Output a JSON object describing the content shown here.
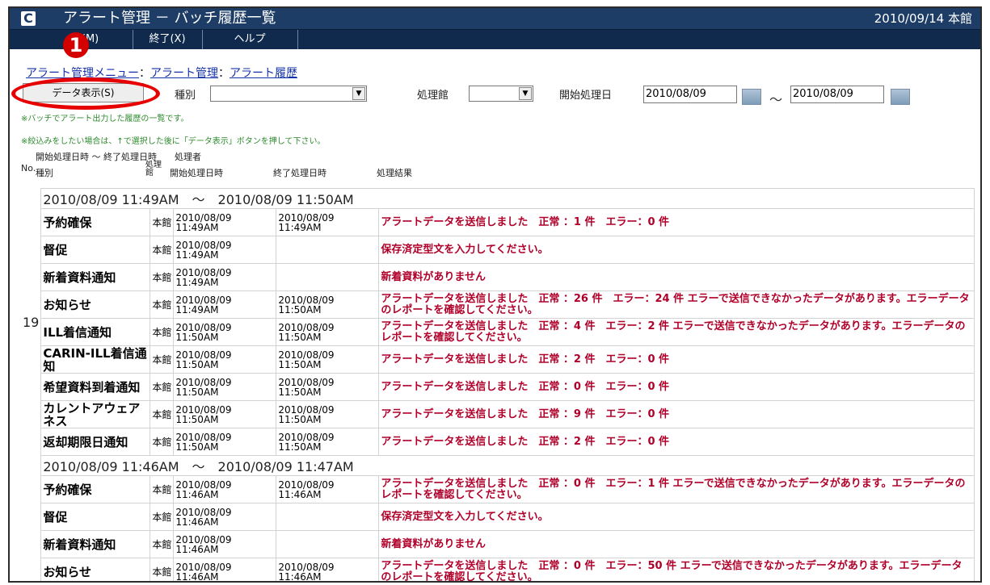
{
  "window": {
    "title": "アラート管理 － バッチ履歴一覧",
    "date_branch": "2010/09/14 本館",
    "logo": "C"
  },
  "menu": {
    "item1": "メ (M)",
    "item2": "終了(X)",
    "item3": "ヘルプ"
  },
  "callout": {
    "number": "1"
  },
  "breadcrumb": {
    "link1": "アラート管理メニュー",
    "sep1": "：",
    "link2": "アラート管理",
    "sep2": "：",
    "link3": "アラート履歴"
  },
  "toolbar": {
    "display_button": "データ表示(S)",
    "type_label": "種別",
    "branch_label": "処理館",
    "start_label": "開始処理日",
    "date_from": "2010/08/09",
    "tilde": "～",
    "date_to": "2010/08/09"
  },
  "info": {
    "line1": "※バッチでアラート出力した履歴の一覧です。",
    "line2": "※絞込みをしたい場合は、↑で選択した後に「データ表示」ボタンを押して下さい。"
  },
  "header": {
    "row1": "開始処理日時 ～ 終了処理日時　　処理者",
    "no": "No.",
    "type": "種別",
    "branch": "処理館",
    "start": "開始処理日時",
    "end": "終了処理日時",
    "result": "処理結果"
  },
  "groups": [
    {
      "no": "19",
      "title": "2010/08/09 11:49AM　～　2010/08/09 11:50AM",
      "rows": [
        {
          "type": "予約確保",
          "branch": "本館",
          "start1": "2010/08/09",
          "start2": "11:49AM",
          "end1": "2010/08/09",
          "end2": "11:49AM",
          "result": "アラートデータを送信しました　正常 ：1 件　エラー：0 件"
        },
        {
          "type": "督促",
          "branch": "本館",
          "start1": "2010/08/09",
          "start2": "11:49AM",
          "end1": "",
          "end2": "",
          "result": "保存済定型文を入力してください。"
        },
        {
          "type": "新着資料通知",
          "branch": "本館",
          "start1": "2010/08/09",
          "start2": "11:49AM",
          "end1": "",
          "end2": "",
          "result": "新着資料がありません"
        },
        {
          "type": "お知らせ",
          "branch": "本館",
          "start1": "2010/08/09",
          "start2": "11:49AM",
          "end1": "2010/08/09",
          "end2": "11:50AM",
          "result": "アラートデータを送信しました　正常 ：26 件　エラー：24 件 エラーで送信できなかったデータがあります。エラーデータのレポートを確認してください。"
        },
        {
          "type": "ILL着信通知",
          "branch": "本館",
          "start1": "2010/08/09",
          "start2": "11:50AM",
          "end1": "2010/08/09",
          "end2": "11:50AM",
          "result": "アラートデータを送信しました　正常 ：4 件　エラー：2 件 エラーで送信できなかったデータがあります。エラーデータのレポートを確認してください。"
        },
        {
          "type": "CARIN-ILL着信通知",
          "branch": "本館",
          "start1": "2010/08/09",
          "start2": "11:50AM",
          "end1": "2010/08/09",
          "end2": "11:50AM",
          "result": "アラートデータを送信しました　正常 ：2 件　エラー：0 件"
        },
        {
          "type": "希望資料到着通知",
          "branch": "本館",
          "start1": "2010/08/09",
          "start2": "11:50AM",
          "end1": "2010/08/09",
          "end2": "11:50AM",
          "result": "アラートデータを送信しました　正常 ：0 件　エラー：0 件"
        },
        {
          "type": "カレントアウェアネス",
          "branch": "本館",
          "start1": "2010/08/09",
          "start2": "11:50AM",
          "end1": "2010/08/09",
          "end2": "11:50AM",
          "result": "アラートデータを送信しました　正常 ：9 件　エラー：0 件"
        },
        {
          "type": "返却期限日通知",
          "branch": "本館",
          "start1": "2010/08/09",
          "start2": "11:50AM",
          "end1": "2010/08/09",
          "end2": "11:50AM",
          "result": "アラートデータを送信しました　正常 ：2 件　エラー：0 件"
        }
      ]
    },
    {
      "no": "",
      "title": "2010/08/09 11:46AM　～　2010/08/09 11:47AM",
      "rows": [
        {
          "type": "予約確保",
          "branch": "本館",
          "start1": "2010/08/09",
          "start2": "11:46AM",
          "end1": "2010/08/09",
          "end2": "11:46AM",
          "result": "アラートデータを送信しました　正常 ：0 件　エラー：1 件 エラーで送信できなかったデータがあります。エラーデータのレポートを確認してください。"
        },
        {
          "type": "督促",
          "branch": "本館",
          "start1": "2010/08/09",
          "start2": "11:46AM",
          "end1": "",
          "end2": "",
          "result": "保存済定型文を入力してください。"
        },
        {
          "type": "新着資料通知",
          "branch": "本館",
          "start1": "2010/08/09",
          "start2": "11:46AM",
          "end1": "",
          "end2": "",
          "result": "新着資料がありません"
        },
        {
          "type": "お知らせ",
          "branch": "本館",
          "start1": "2010/08/09",
          "start2": "11:46AM",
          "end1": "2010/08/09",
          "end2": "11:46AM",
          "result": "アラートデータを送信しました　正常 ：0 件　エラー：50 件 エラーで送信できなかったデータがあります。エラーデータのレポートを確認してください。"
        }
      ]
    }
  ]
}
